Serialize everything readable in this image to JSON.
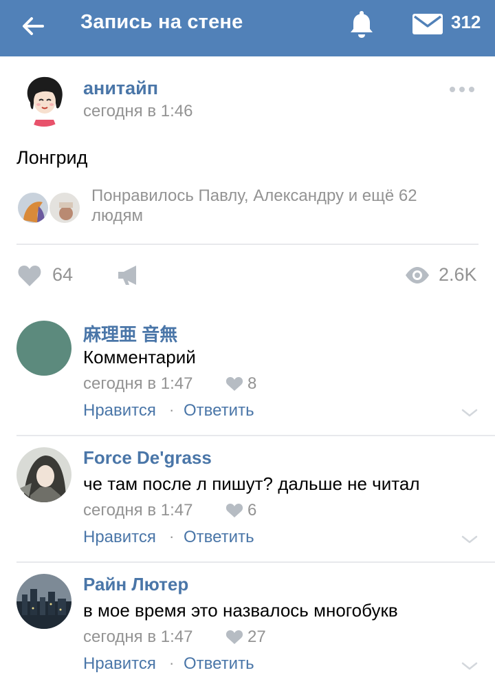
{
  "header": {
    "title": "Запись на стене",
    "message_count": "312",
    "bg_color": "#5181b8"
  },
  "post": {
    "author": "анитайп",
    "time": "сегодня в 1:46",
    "text": "Лонгрид",
    "likes_text": "Понравилось Павлу, Александру и ещё 62 людям",
    "like_count": "64",
    "views": "2.6K"
  },
  "comments": [
    {
      "name": "麻理亜 音無",
      "text": "Комментарий",
      "time": "сегодня в 1:47",
      "likes": "8",
      "like_label": "Нравится",
      "separator": "·",
      "reply_label": "Ответить",
      "avatar_color": "#5c8a7d"
    },
    {
      "name": "Force De'grass",
      "text": "че там после л пишут? дальше не читал",
      "time": "сегодня в 1:47",
      "likes": "6",
      "like_label": "Нравится",
      "separator": "·",
      "reply_label": "Ответить",
      "avatar_color": "#b9bdb6"
    },
    {
      "name": "Райн Лютер",
      "text": "в мое время это назвалось многобукв",
      "time": "сегодня в 1:47",
      "likes": "27",
      "like_label": "Нравится",
      "separator": "·",
      "reply_label": "Ответить",
      "avatar_color": "#2a3440"
    }
  ],
  "icons": {
    "back": "arrow-left-icon",
    "notifications": "bell-icon",
    "messages": "envelope-icon",
    "more": "more-dots-icon",
    "like": "heart-icon",
    "share": "megaphone-icon",
    "views": "eye-icon",
    "expand": "chevron-down-icon"
  },
  "colors": {
    "link": "#4a76a8",
    "secondary_text": "#939393",
    "icon_gray": "#a0a6ad",
    "divider": "#e7e8ec"
  }
}
